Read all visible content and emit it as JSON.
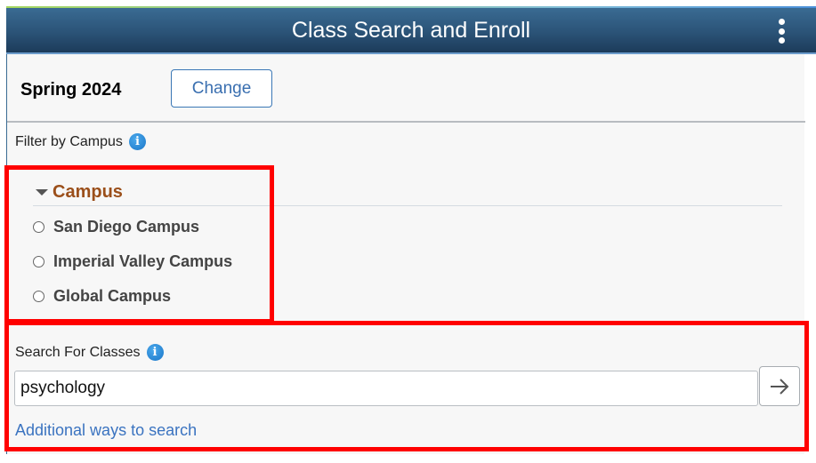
{
  "header": {
    "title": "Class Search and Enroll",
    "menu_icon": "kebab-menu-icon"
  },
  "term": {
    "label": "Spring 2024",
    "change_label": "Change"
  },
  "filter": {
    "label": "Filter by Campus",
    "info_icon": "info-icon",
    "group_title": "Campus",
    "options": [
      {
        "label": "San Diego Campus",
        "selected": false
      },
      {
        "label": "Imperial Valley Campus",
        "selected": false
      },
      {
        "label": "Global Campus",
        "selected": false
      }
    ]
  },
  "search": {
    "label": "Search For Classes",
    "info_icon": "info-icon",
    "value": "psychology",
    "submit_icon": "arrow-right-icon",
    "additional_link": "Additional ways to search"
  },
  "colors": {
    "header_bg": "#2b5377",
    "link": "#3a73c0",
    "group_title": "#9b4f1a",
    "annotation": "#ff0000"
  }
}
